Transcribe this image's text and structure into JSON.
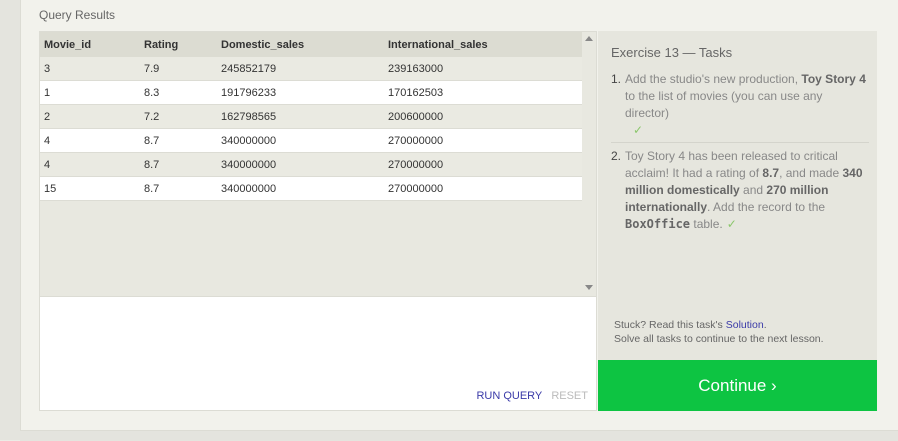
{
  "section_title": "Query Results",
  "results": {
    "columns": [
      "Movie_id",
      "Rating",
      "Domestic_sales",
      "International_sales"
    ],
    "rows": [
      [
        "3",
        "7.9",
        "245852179",
        "239163000"
      ],
      [
        "1",
        "8.3",
        "191796233",
        "170162503"
      ],
      [
        "2",
        "7.2",
        "162798565",
        "200600000"
      ],
      [
        "4",
        "8.7",
        "340000000",
        "270000000"
      ],
      [
        "4",
        "8.7",
        "340000000",
        "270000000"
      ],
      [
        "15",
        "8.7",
        "340000000",
        "270000000"
      ]
    ]
  },
  "editor": {
    "run_label": "RUN QUERY",
    "reset_label": "RESET"
  },
  "exercise": {
    "heading": "Exercise 13 — Tasks",
    "tasks": [
      {
        "number": "1.",
        "text_1": "Add the studio's new production, ",
        "bold_1": "Toy Story 4",
        "text_2": " to the list of movies (you can use any director)",
        "check": "✓"
      },
      {
        "number": "2.",
        "text_1": "Toy Story 4 has been released to critical acclaim! It had a rating of ",
        "bold_1": "8.7",
        "text_2": ", and made ",
        "bold_2": "340 million domestically",
        "text_3": " and ",
        "bold_3": "270 million internationally",
        "text_4": ". Add the record to the ",
        "code": "BoxOffice",
        "text_5": " table.",
        "check": "✓"
      }
    ],
    "help_prefix": "Stuck? Read this task's ",
    "solution_link": "Solution",
    "help_suffix": ".",
    "help_line2": "Solve all tasks to continue to the next lesson."
  },
  "continue_label": "Continue ›",
  "colors": {
    "continue_bg": "#0dc442",
    "link": "#3a3aa8",
    "check": "#8bc76b"
  }
}
